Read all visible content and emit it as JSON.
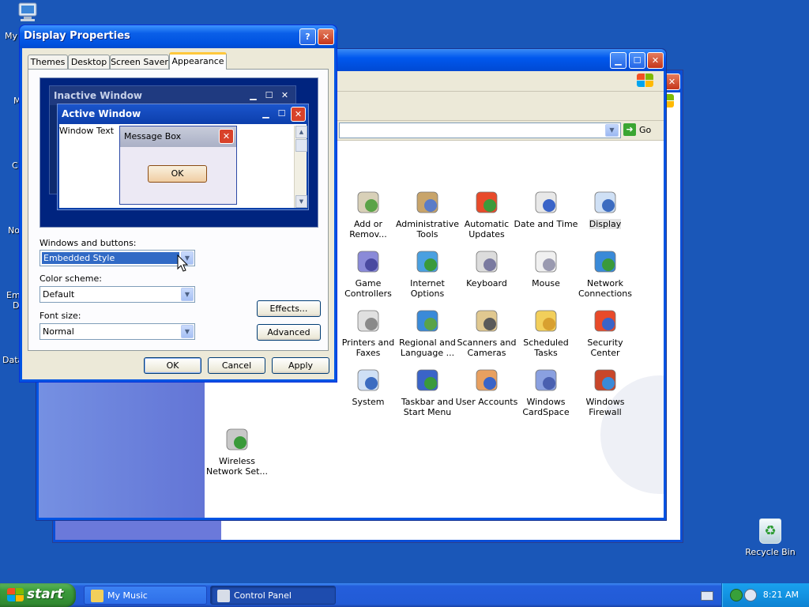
{
  "desktop": {
    "edge_labels": [
      "My",
      "M",
      "C",
      "No",
      "Em",
      "D",
      "Data"
    ],
    "recycle_bin": "Recycle Bin"
  },
  "control_panel": {
    "go_label": "Go",
    "items": [
      {
        "label": "Add or Remov...",
        "icon": "add-remove-programs-icon"
      },
      {
        "label": "Administrative Tools",
        "icon": "administrative-tools-icon"
      },
      {
        "label": "Automatic Updates",
        "icon": "automatic-updates-icon"
      },
      {
        "label": "Date and Time",
        "icon": "date-time-icon"
      },
      {
        "label": "Display",
        "icon": "display-icon"
      },
      {
        "label": "Game Controllers",
        "icon": "game-controllers-icon"
      },
      {
        "label": "Internet Options",
        "icon": "internet-options-icon"
      },
      {
        "label": "Keyboard",
        "icon": "keyboard-icon"
      },
      {
        "label": "Mouse",
        "icon": "mouse-icon"
      },
      {
        "label": "Network Connections",
        "icon": "network-connections-icon"
      },
      {
        "label": "Printers and Faxes",
        "icon": "printers-faxes-icon"
      },
      {
        "label": "Regional and Language ...",
        "icon": "regional-language-icon"
      },
      {
        "label": "Scanners and Cameras",
        "icon": "scanners-cameras-icon"
      },
      {
        "label": "Scheduled Tasks",
        "icon": "scheduled-tasks-icon"
      },
      {
        "label": "Security Center",
        "icon": "security-center-icon"
      },
      {
        "label": "System",
        "icon": "system-icon"
      },
      {
        "label": "Taskbar and Start Menu",
        "icon": "taskbar-start-menu-icon"
      },
      {
        "label": "User Accounts",
        "icon": "user-accounts-icon"
      },
      {
        "label": "Windows CardSpace",
        "icon": "windows-cardspace-icon"
      },
      {
        "label": "Windows Firewall",
        "icon": "windows-firewall-icon"
      },
      {
        "label": "Wireless Network Set...",
        "icon": "wireless-network-icon"
      }
    ]
  },
  "dialog": {
    "title": "Display Properties",
    "help_symbol": "?",
    "tabs": [
      {
        "label": "Themes"
      },
      {
        "label": "Desktop"
      },
      {
        "label": "Screen Saver"
      },
      {
        "label": "Appearance",
        "active": true
      }
    ],
    "preview": {
      "inactive_window": "Inactive Window",
      "active_window": "Active Window",
      "window_text": "Window Text",
      "message_box": "Message Box",
      "ok": "OK"
    },
    "windows_buttons_label": "Windows and buttons:",
    "windows_buttons_value": "Embedded Style",
    "color_scheme_label": "Color scheme:",
    "color_scheme_value": "Default",
    "font_size_label": "Font size:",
    "font_size_value": "Normal",
    "effects_button": "Effects...",
    "advanced_button": "Advanced",
    "ok_button": "OK",
    "cancel_button": "Cancel",
    "apply_button": "Apply"
  },
  "taskbar": {
    "start_label": "start",
    "tasks": [
      {
        "label": "My Music",
        "active": false
      },
      {
        "label": "Control Panel",
        "active": true
      }
    ],
    "clock": "8:21 AM"
  },
  "colors": {
    "desktop": "#1a57b8",
    "title_blue": "#0054e3",
    "start_green": "#3c9c3c",
    "close_red": "#c5361b",
    "selection": "#316ac5"
  }
}
